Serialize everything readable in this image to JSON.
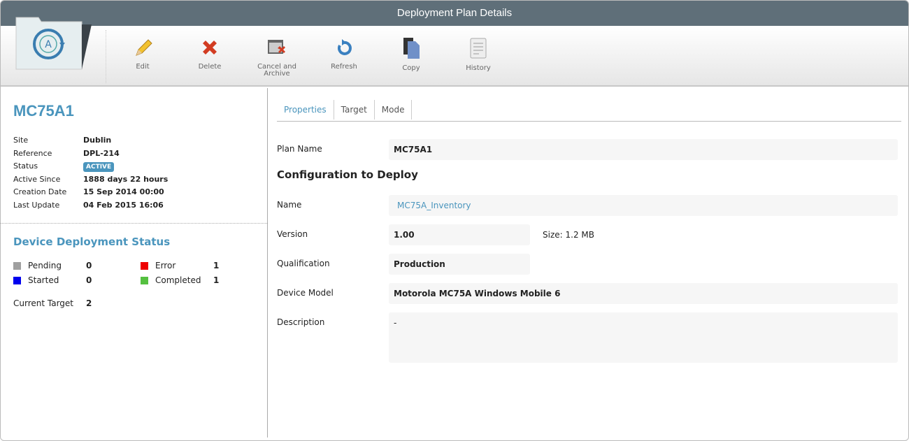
{
  "title": "Deployment Plan Details",
  "toolbar": {
    "edit": "Edit",
    "delete": "Delete",
    "cancel1": "Cancel and",
    "cancel2": "Archive",
    "refresh": "Refresh",
    "copy": "Copy",
    "history": "History"
  },
  "plan": {
    "name": "MC75A1",
    "info": [
      {
        "k": "Site",
        "v": "Dublin"
      },
      {
        "k": "Reference",
        "v": "DPL-214"
      },
      {
        "k": "Status",
        "v": "ACTIVE"
      },
      {
        "k": "Active Since",
        "v": "1888 days 22 hours"
      },
      {
        "k": "Creation Date",
        "v": "15 Sep 2014 00:00"
      },
      {
        "k": "Last Update",
        "v": "04 Feb 2015 16:06"
      }
    ]
  },
  "status": {
    "title": "Device Deployment Status",
    "items": [
      {
        "label": "Pending",
        "value": "0",
        "color": "#a0a0a0"
      },
      {
        "label": "Started",
        "value": "0",
        "color": "#0000ee"
      },
      {
        "label": "Error",
        "value": "1",
        "color": "#ee0000"
      },
      {
        "label": "Completed",
        "value": "1",
        "color": "#55c040"
      }
    ],
    "current_target_label": "Current Target",
    "current_target": "2"
  },
  "tabs": [
    "Properties",
    "Target",
    "Mode"
  ],
  "props": {
    "plan_name_label": "Plan Name",
    "plan_name": "MC75A1",
    "section": "Configuration to Deploy",
    "name_label": "Name",
    "name": "MC75A_Inventory",
    "version_label": "Version",
    "version": "1.00",
    "size": "Size: 1.2 MB",
    "qual_label": "Qualification",
    "qual": "Production",
    "model_label": "Device Model",
    "model": "Motorola MC75A Windows Mobile 6",
    "desc_label": "Description",
    "desc": "-"
  }
}
